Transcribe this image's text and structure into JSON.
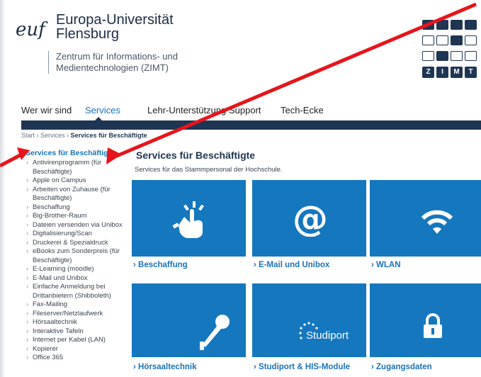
{
  "header": {
    "university_line1": "Europa-Universität",
    "university_line2": "Flensburg",
    "center_line1": "Zentrum für Informations- und",
    "center_line2": "Medientechnologien (ZIMT)",
    "logo_mark_text": "euf",
    "zimt_letters": [
      "Z",
      "I",
      "M",
      "T"
    ]
  },
  "nav": {
    "items": [
      {
        "label": "Wer wir sind"
      },
      {
        "label": "Services"
      },
      {
        "label": "Lehr-Unterstützung"
      },
      {
        "label": "Support"
      },
      {
        "label": "Tech-Ecke"
      }
    ]
  },
  "breadcrumb": {
    "start": "Start",
    "sep": " › ",
    "services": "Services",
    "current": "Services für Beschäftigte"
  },
  "sidebar": {
    "heading": "Services für Beschäftigte",
    "items": [
      "Antivirenprogramm (für Beschäftigte)",
      "Apple on Campus",
      "Arbeiten von Zuhause (für Beschäftigte)",
      "Beschaffung",
      "Big-Brother-Raum",
      "Dateien versenden via Unibox",
      "Digitalisierung/Scan",
      "Druckerei & Spezialdruck",
      "eBooks zum Sonderpreis (für Beschäftigte)",
      "E-Learning (moodle)",
      "E-Mail und Unibox",
      "Einfache Anmeldung bei Drittanbietern (Shibboleth)",
      "Fax-Mailing",
      "Fileserver/Netzlaufwerk",
      "Hörsaaltechnik",
      "Interaktive Tafeln",
      "Internet per Kabel (LAN)",
      "Kopierer",
      "Office 365"
    ]
  },
  "main": {
    "title": "Services für Beschäftigte",
    "description": "Services für das Stammpersonal der Hochschule.",
    "tiles": [
      {
        "label": "› Beschaffung",
        "icon": "hand-pointer-icon"
      },
      {
        "label": "› E-Mail und Unibox",
        "icon": "at-sign-icon"
      },
      {
        "label": "› WLAN",
        "icon": "wifi-icon"
      },
      {
        "label": "› Hörsaaltechnik",
        "icon": "microphone-icon"
      },
      {
        "label": "› Studiport & HIS-Module",
        "icon": "studiport-icon",
        "icon_text": "Studiport"
      },
      {
        "label": "› Zugangsdaten",
        "icon": "lock-icon"
      }
    ]
  },
  "colors": {
    "navy": "#1e3553",
    "tile_blue": "#1577be",
    "link_blue": "#1a73b8",
    "arrow_red": "#e8141b"
  }
}
